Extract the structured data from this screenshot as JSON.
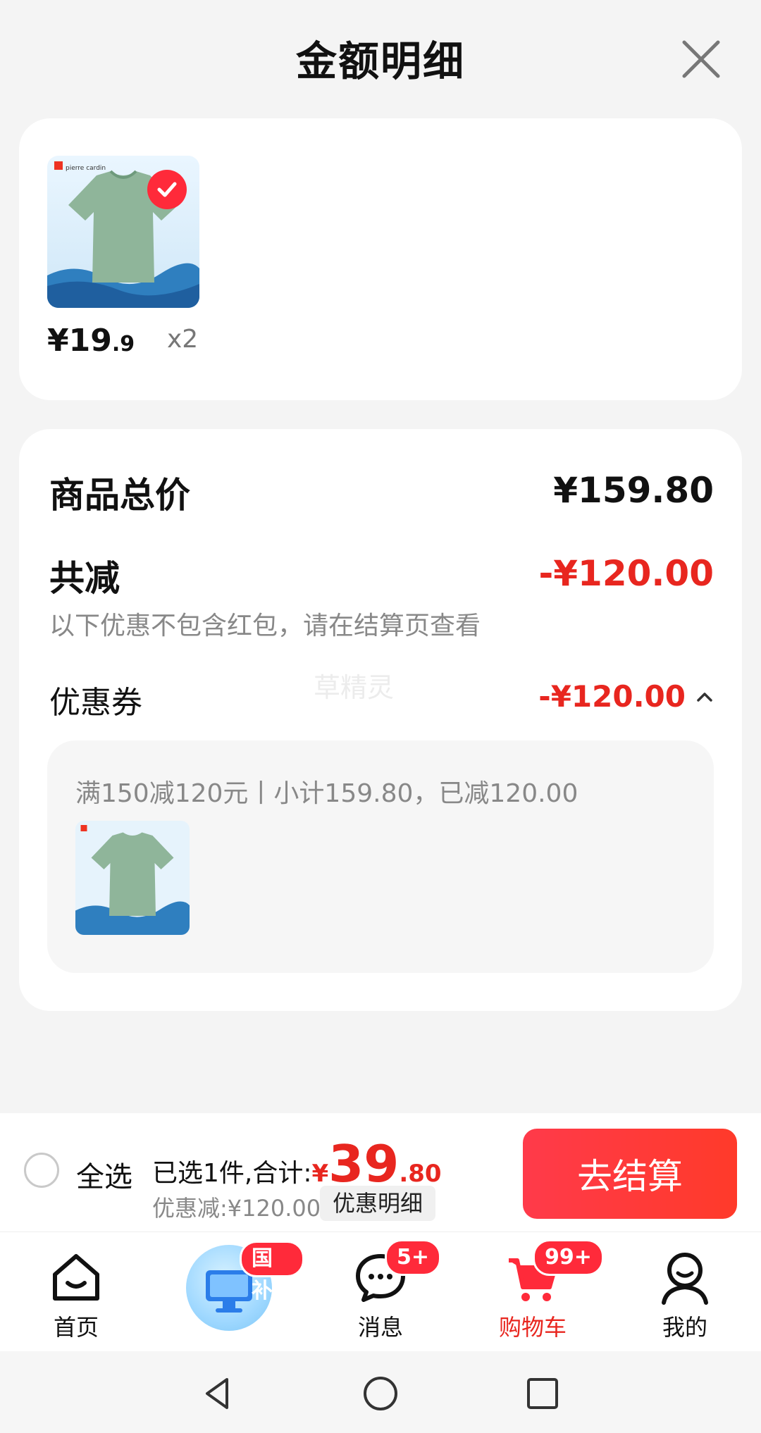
{
  "sheet": {
    "title": "金额明细"
  },
  "item": {
    "price_int": "¥19",
    "price_dec": ".9",
    "qty": "x2"
  },
  "summary": {
    "total_label": "商品总价",
    "total_value": "¥159.80",
    "minus_label": "共减",
    "minus_value": "-¥120.00",
    "minus_note": "以下优惠不包含红包，请在结算页查看",
    "coupon_label": "优惠券",
    "coupon_value": "-¥120.00",
    "watermark": "草精灵",
    "coupon_detail": "满150减120元丨小计159.80，已减120.00"
  },
  "checkout": {
    "select_all": "全选",
    "selected_text": "已选1件,合计:",
    "currency": "¥",
    "amount_int": "39",
    "amount_dec": ".80",
    "discount_text": "优惠减:¥120.00",
    "detail_button": "优惠明细",
    "pay_button": "去结算"
  },
  "tabs": [
    {
      "label": "首页",
      "icon": "home-icon"
    },
    {
      "label": "",
      "icon": "gov-subsidy-icon",
      "badge": "国补"
    },
    {
      "label": "消息",
      "icon": "message-icon",
      "badge": "5+"
    },
    {
      "label": "购物车",
      "icon": "cart-icon",
      "badge": "99+"
    },
    {
      "label": "我的",
      "icon": "profile-icon"
    }
  ],
  "colors": {
    "accent": "#e8261f",
    "button": "#ff3a4a",
    "background": "#f4f4f4"
  }
}
